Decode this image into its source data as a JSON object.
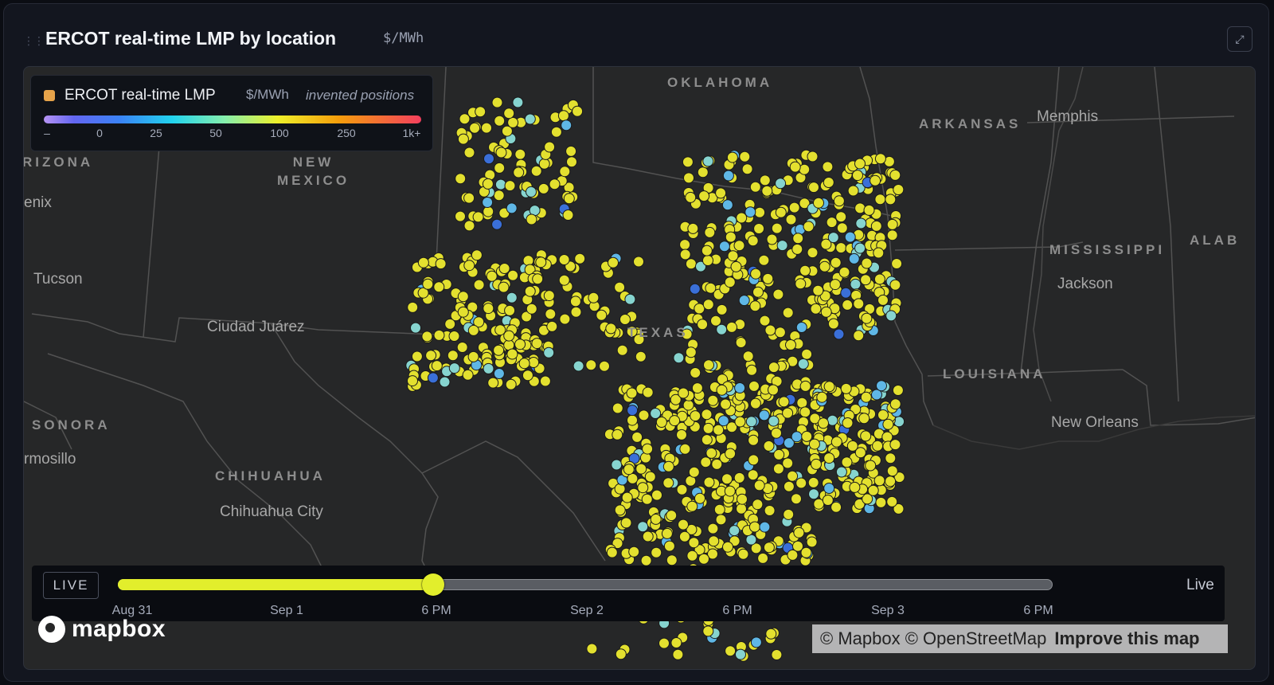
{
  "panel": {
    "title": "ERCOT real-time LMP by location",
    "unit": "$/MWh"
  },
  "legend": {
    "title": "ERCOT real-time LMP",
    "unit": "$/MWh",
    "note": "invented positions",
    "swatch_color": "#e6a34a",
    "ticks": [
      "–",
      "0",
      "25",
      "50",
      "100",
      "250",
      "1k+"
    ]
  },
  "map": {
    "regions": [
      {
        "id": "oklahoma",
        "text": "OKLAHOMA"
      },
      {
        "id": "arkansas",
        "text": "ARKANSAS"
      },
      {
        "id": "arizona",
        "text": "RIZONA"
      },
      {
        "id": "new-mexico-1",
        "text": "NEW"
      },
      {
        "id": "new-mexico-2",
        "text": "MEXICO"
      },
      {
        "id": "mississippi",
        "text": "MISSISSIPPI"
      },
      {
        "id": "alabama",
        "text": "ALAB"
      },
      {
        "id": "texas",
        "text": "TEXAS"
      },
      {
        "id": "louisiana",
        "text": "LOUISIANA"
      },
      {
        "id": "sonora",
        "text": "SONORA"
      },
      {
        "id": "chihuahua",
        "text": "CHIHUAHUA"
      }
    ],
    "cities": [
      {
        "id": "memphis",
        "text": "Memphis"
      },
      {
        "id": "phoenix",
        "text": "enix"
      },
      {
        "id": "jackson",
        "text": "Jackson"
      },
      {
        "id": "tucson",
        "text": "Tucson"
      },
      {
        "id": "ciudad-juarez",
        "text": "Ciudad Juárez"
      },
      {
        "id": "new-orleans",
        "text": "New Orleans"
      },
      {
        "id": "hermosillo",
        "text": "rmosillo"
      },
      {
        "id": "chihuahua-city",
        "text": "Chihuahua City"
      }
    ],
    "point_colors": {
      "typical": "#e3e02f",
      "low": "#86d4cf",
      "lower": "#5fb7e6",
      "lowest": "#3a6fd8"
    }
  },
  "timeline": {
    "live_badge": "LIVE",
    "live_label": "Live",
    "ticks": [
      "Aug 31",
      "Sep 1",
      "6 PM",
      "Sep 2",
      "6 PM",
      "Sep 3",
      "6 PM"
    ],
    "progress": 0.337
  },
  "footer": {
    "logo_text": "mapbox",
    "attribution": "© Mapbox © OpenStreetMap",
    "improve_link": "Improve this map"
  }
}
